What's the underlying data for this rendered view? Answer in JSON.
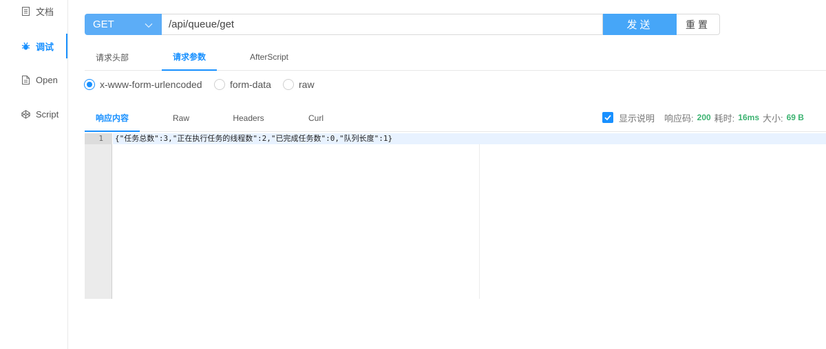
{
  "sidebar": {
    "items": [
      {
        "label": "文档",
        "icon": "document-icon",
        "active": false
      },
      {
        "label": "调试",
        "icon": "bug-icon",
        "active": true
      },
      {
        "label": "Open",
        "icon": "file-icon",
        "active": false
      },
      {
        "label": "Script",
        "icon": "codepen-icon",
        "active": false
      }
    ]
  },
  "request": {
    "method": "GET",
    "url": "/api/queue/get",
    "send_label": "发送",
    "reset_label": "重置"
  },
  "request_tabs": [
    {
      "label": "请求头部",
      "active": false
    },
    {
      "label": "请求参数",
      "active": true
    },
    {
      "label": "AfterScript",
      "active": false
    }
  ],
  "body_types": [
    {
      "label": "x-www-form-urlencoded",
      "checked": true
    },
    {
      "label": "form-data",
      "checked": false
    },
    {
      "label": "raw",
      "checked": false
    }
  ],
  "response_tabs": [
    {
      "label": "响应内容",
      "active": true
    },
    {
      "label": "Raw",
      "active": false
    },
    {
      "label": "Headers",
      "active": false
    },
    {
      "label": "Curl",
      "active": false
    }
  ],
  "response_meta": {
    "show_desc_label": "显示说明",
    "show_desc_checked": true,
    "status_label": "响应码:",
    "status_value": "200",
    "time_label": "耗时:",
    "time_value": "16ms",
    "size_label": "大小:",
    "size_value": "69 B"
  },
  "editor": {
    "lines": [
      {
        "number": "1",
        "text": "{\"任务总数\":3,\"正在执行任务的线程数\":2,\"已完成任务数\":0,\"队列长度\":1}"
      }
    ]
  },
  "colors": {
    "accent": "#1890ff",
    "method_bg": "#5cadf7",
    "send_bg": "#46a6f8",
    "meta_value": "#3cb371"
  }
}
